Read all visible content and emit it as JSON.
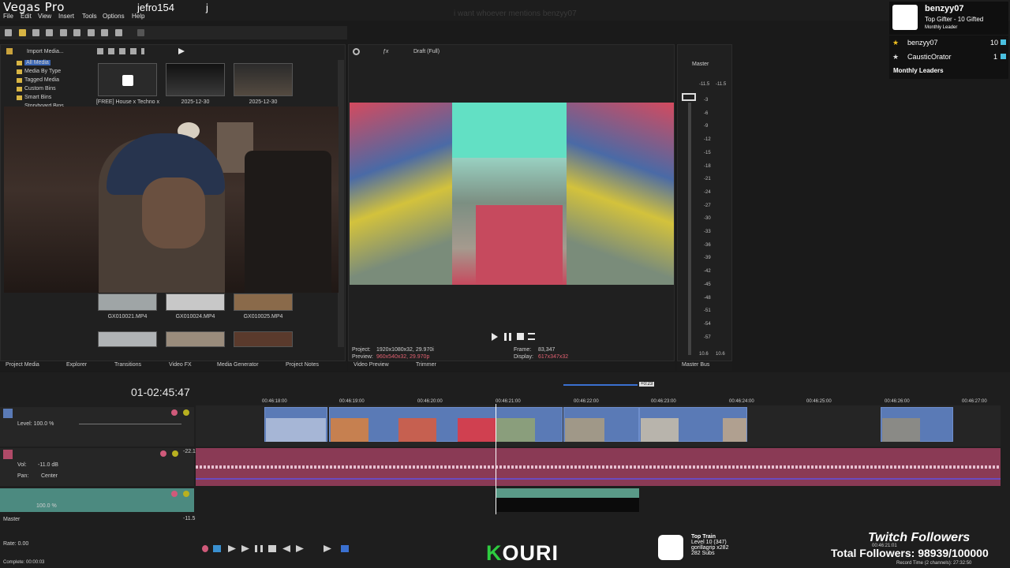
{
  "app": {
    "title": "Vegas Pro",
    "chat_user": "jefro154",
    "chat_j": "j",
    "banner": "i want whoever mentions benzyy07"
  },
  "menu": [
    "File",
    "Edit",
    "View",
    "Insert",
    "Tools",
    "Options",
    "Help"
  ],
  "project_media": {
    "import_label": "Import Media...",
    "tree": [
      "All Media",
      "Media By Type",
      "Tagged Media",
      "Custom Bins",
      "Smart Bins",
      "Storyboard Bins"
    ],
    "thumbs_top": [
      "[FREE] House x Techno x",
      "2025-12-30",
      "2025-12-30"
    ],
    "thumbs_bottom": [
      "GX010021.MP4",
      "GX010024.MP4",
      "GX010025.MP4"
    ]
  },
  "left_tabs": [
    "Project Media",
    "Explorer",
    "Transitions",
    "Video FX",
    "Media Generator",
    "Project Notes"
  ],
  "preview": {
    "quality": "Draft (Full)",
    "project_label": "Project:",
    "project_value": "1920x1080x32, 29.970i",
    "preview_label": "Preview:",
    "preview_value": "960x540x32, 29.970p",
    "frame_label": "Frame:",
    "frame_value": "83,347",
    "display_label": "Display:",
    "display_value": "617x347x32",
    "tabs": [
      "Video Preview",
      "Trimmer"
    ]
  },
  "master": {
    "label": "Master",
    "peak_left": "-11.5",
    "peak_right": "-11.5",
    "scale": [
      "3",
      "6",
      "9",
      "12",
      "15",
      "18",
      "21",
      "24",
      "27",
      "30",
      "33",
      "36",
      "39",
      "42",
      "45",
      "48",
      "51",
      "54",
      "57"
    ],
    "bottom_left": "10.6",
    "bottom_right": "10.6",
    "tab": "Master Bus"
  },
  "overlay": {
    "gifter_name": "benzyy07",
    "gifter_title": "Top Gifter - 10 Gifted",
    "gifter_sub": "Monthly Leader",
    "leaders": [
      {
        "name": "benzyy07",
        "count": "10"
      },
      {
        "name": "CausticOrator",
        "count": "1"
      }
    ],
    "leaders_title": "Monthly Leaders"
  },
  "timeline": {
    "timecode": "01-02:45:47",
    "ruler": [
      "00:46:18:00",
      "00:46:19:00",
      "00:46:20:00",
      "00:46:21:00",
      "00:46:22:00",
      "00:46:23:00",
      "00:46:24:00",
      "00:46:25:00",
      "00:46:26:00",
      "00:46:27:00"
    ],
    "cursor_label": "+0:23",
    "video_level": "Level: 100.0 %",
    "audio_vol": "-11.0 dB",
    "audio_vol_label": "Vol:",
    "audio_pan_label": "Pan:",
    "audio_pan": "Center",
    "audio_db": "-22.1",
    "track2_level": "100.0 %",
    "master_label": "Master",
    "master_db": "-11.5",
    "rate": "Rate: 0.00",
    "complete": "Complete: 00:00:03",
    "record_time": "Record Time (2 channels): 27:32:50",
    "end_time": "00:46:21:01"
  },
  "stream": {
    "kouri": "OURI",
    "kouri_k": "K",
    "train_title": "Top Train",
    "train_level": "Level 10 (347)",
    "train_user": "gorillagrip x282",
    "train_subs": "282 Subs",
    "followers_title": "Twitch Followers",
    "followers_count": "Total Followers: 98939/100000"
  }
}
